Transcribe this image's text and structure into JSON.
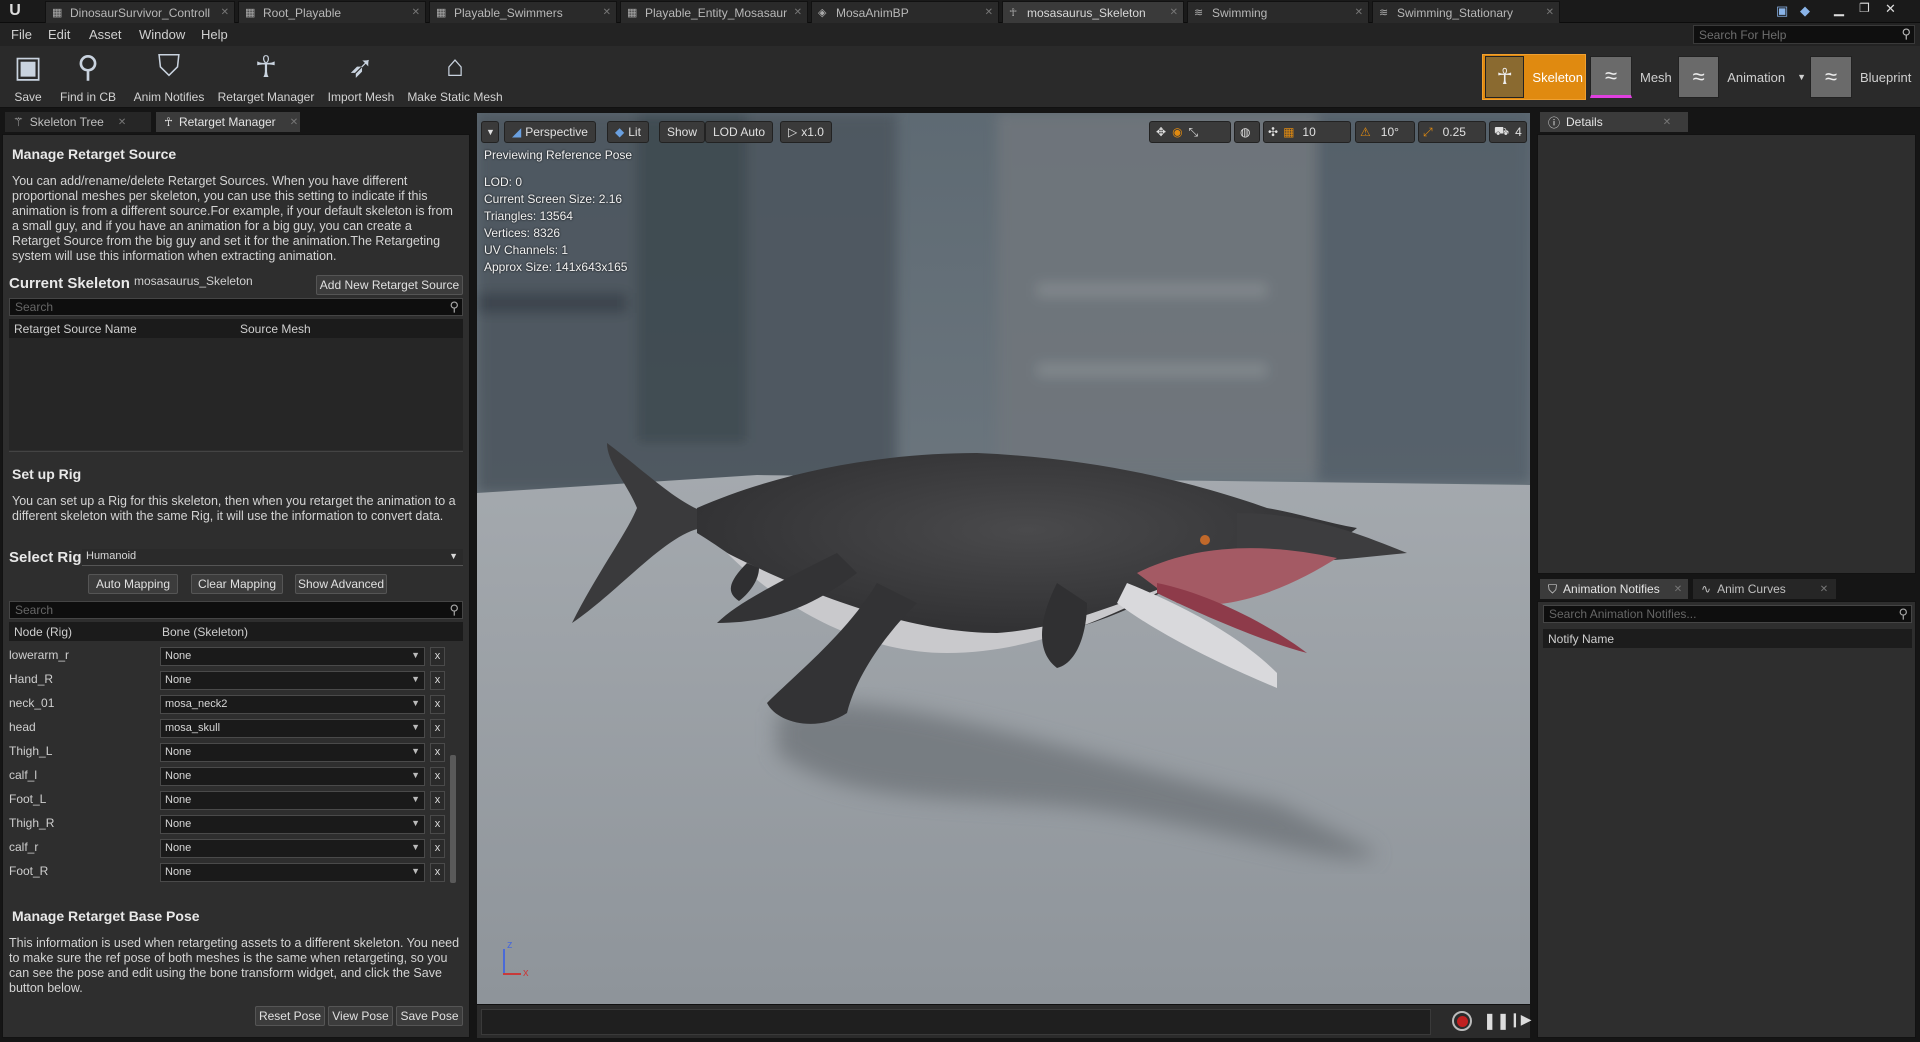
{
  "tabs": [
    {
      "label": "DinosaurSurvivor_Controll",
      "icon": "blueprint-icon"
    },
    {
      "label": "Root_Playable",
      "icon": "blueprint-icon"
    },
    {
      "label": "Playable_Swimmers",
      "icon": "blueprint-icon"
    },
    {
      "label": "Playable_Entity_Mosasaur",
      "icon": "blueprint-icon"
    },
    {
      "label": "MosaAnimBP",
      "icon": "animbp-icon"
    },
    {
      "label": "mosasaurus_Skeleton",
      "icon": "skeleton-icon"
    },
    {
      "label": "Swimming",
      "icon": "animation-icon"
    },
    {
      "label": "Swimming_Stationary",
      "icon": "animation-icon"
    }
  ],
  "menu": [
    "File",
    "Edit",
    "Asset",
    "Window",
    "Help"
  ],
  "help_search_placeholder": "Search For Help",
  "toolbar": [
    {
      "label": "Save",
      "icon": "save-icon"
    },
    {
      "label": "Find in CB",
      "icon": "find-in-content-browser-icon"
    },
    {
      "label": "Anim Notifies",
      "icon": "anim-notifies-icon"
    },
    {
      "label": "Retarget Manager",
      "icon": "retarget-manager-icon"
    },
    {
      "label": "Import Mesh",
      "icon": "import-mesh-icon"
    },
    {
      "label": "Make Static Mesh",
      "icon": "make-static-mesh-icon"
    }
  ],
  "modes": [
    {
      "label": "Skeleton",
      "active": true
    },
    {
      "label": "Mesh",
      "active": false
    },
    {
      "label": "Animation",
      "active": false
    },
    {
      "label": "Blueprint",
      "active": false
    }
  ],
  "left_tabs": [
    "Skeleton Tree",
    "Retarget Manager"
  ],
  "retarget_source": {
    "title": "Manage Retarget Source",
    "description": "You can add/rename/delete Retarget Sources. When you have different proportional meshes per skeleton, you can use this setting to indicate if this animation is from a different source.For example, if your default skeleton is from a small guy, and if you have an animation for a big guy, you can create a Retarget Source from the big guy and set it for the animation.The Retargeting system will use this information when extracting animation.",
    "current_label": "Current Skeleton",
    "current_value": "mosasaurus_Skeleton",
    "add_button": "Add New Retarget Source",
    "search_placeholder": "Search",
    "columns": [
      "Retarget Source Name",
      "Source Mesh"
    ]
  },
  "rig": {
    "title": "Set up Rig",
    "description": "You can set up a Rig for this skeleton, then when you retarget the animation to a different skeleton with the same Rig, it will use the information to convert data.",
    "select_label": "Select Rig",
    "selected_rig": "Humanoid",
    "buttons": [
      "Auto Mapping",
      "Clear Mapping",
      "Show Advanced"
    ],
    "search_placeholder": "Search",
    "columns": [
      "Node (Rig)",
      "Bone (Skeleton)"
    ],
    "rows": [
      {
        "node": "lowerarm_r",
        "bone": "None"
      },
      {
        "node": "Hand_R",
        "bone": "None"
      },
      {
        "node": "neck_01",
        "bone": "mosa_neck2"
      },
      {
        "node": "head",
        "bone": "mosa_skull"
      },
      {
        "node": "Thigh_L",
        "bone": "None"
      },
      {
        "node": "calf_l",
        "bone": "None"
      },
      {
        "node": "Foot_L",
        "bone": "None"
      },
      {
        "node": "Thigh_R",
        "bone": "None"
      },
      {
        "node": "calf_r",
        "bone": "None"
      },
      {
        "node": "Foot_R",
        "bone": "None"
      }
    ],
    "clear_glyph": "x"
  },
  "base_pose": {
    "title": "Manage Retarget Base Pose",
    "description": "This information is used when retargeting assets to a different skeleton. You need to make sure the ref pose of both meshes is the same when retargeting, so you can see the pose and edit using the bone transform widget, and click the Save button below.",
    "buttons": [
      "Reset Pose",
      "View Pose",
      "Save Pose"
    ]
  },
  "viewport": {
    "buttons": {
      "perspective": "Perspective",
      "lit": "Lit",
      "show": "Show",
      "lod": "LOD Auto",
      "speed": "x1.0"
    },
    "grid_snap": "10",
    "rot_snap": "10°",
    "scale_snap": "0.25",
    "cam_speed": "4",
    "preview_label": "Previewing Reference Pose",
    "stats": [
      "LOD: 0",
      "Current Screen Size: 2.16",
      "Triangles: 13564",
      "Vertices: 8326",
      "UV Channels: 1",
      "Approx Size: 141x643x165"
    ],
    "axis_z": "z",
    "axis_x": "x"
  },
  "details_tab": "Details",
  "notify_tabs": [
    "Animation Notifies",
    "Anim Curves"
  ],
  "notify_search_placeholder": "Search Animation Notifies...",
  "notify_column": "Notify Name"
}
